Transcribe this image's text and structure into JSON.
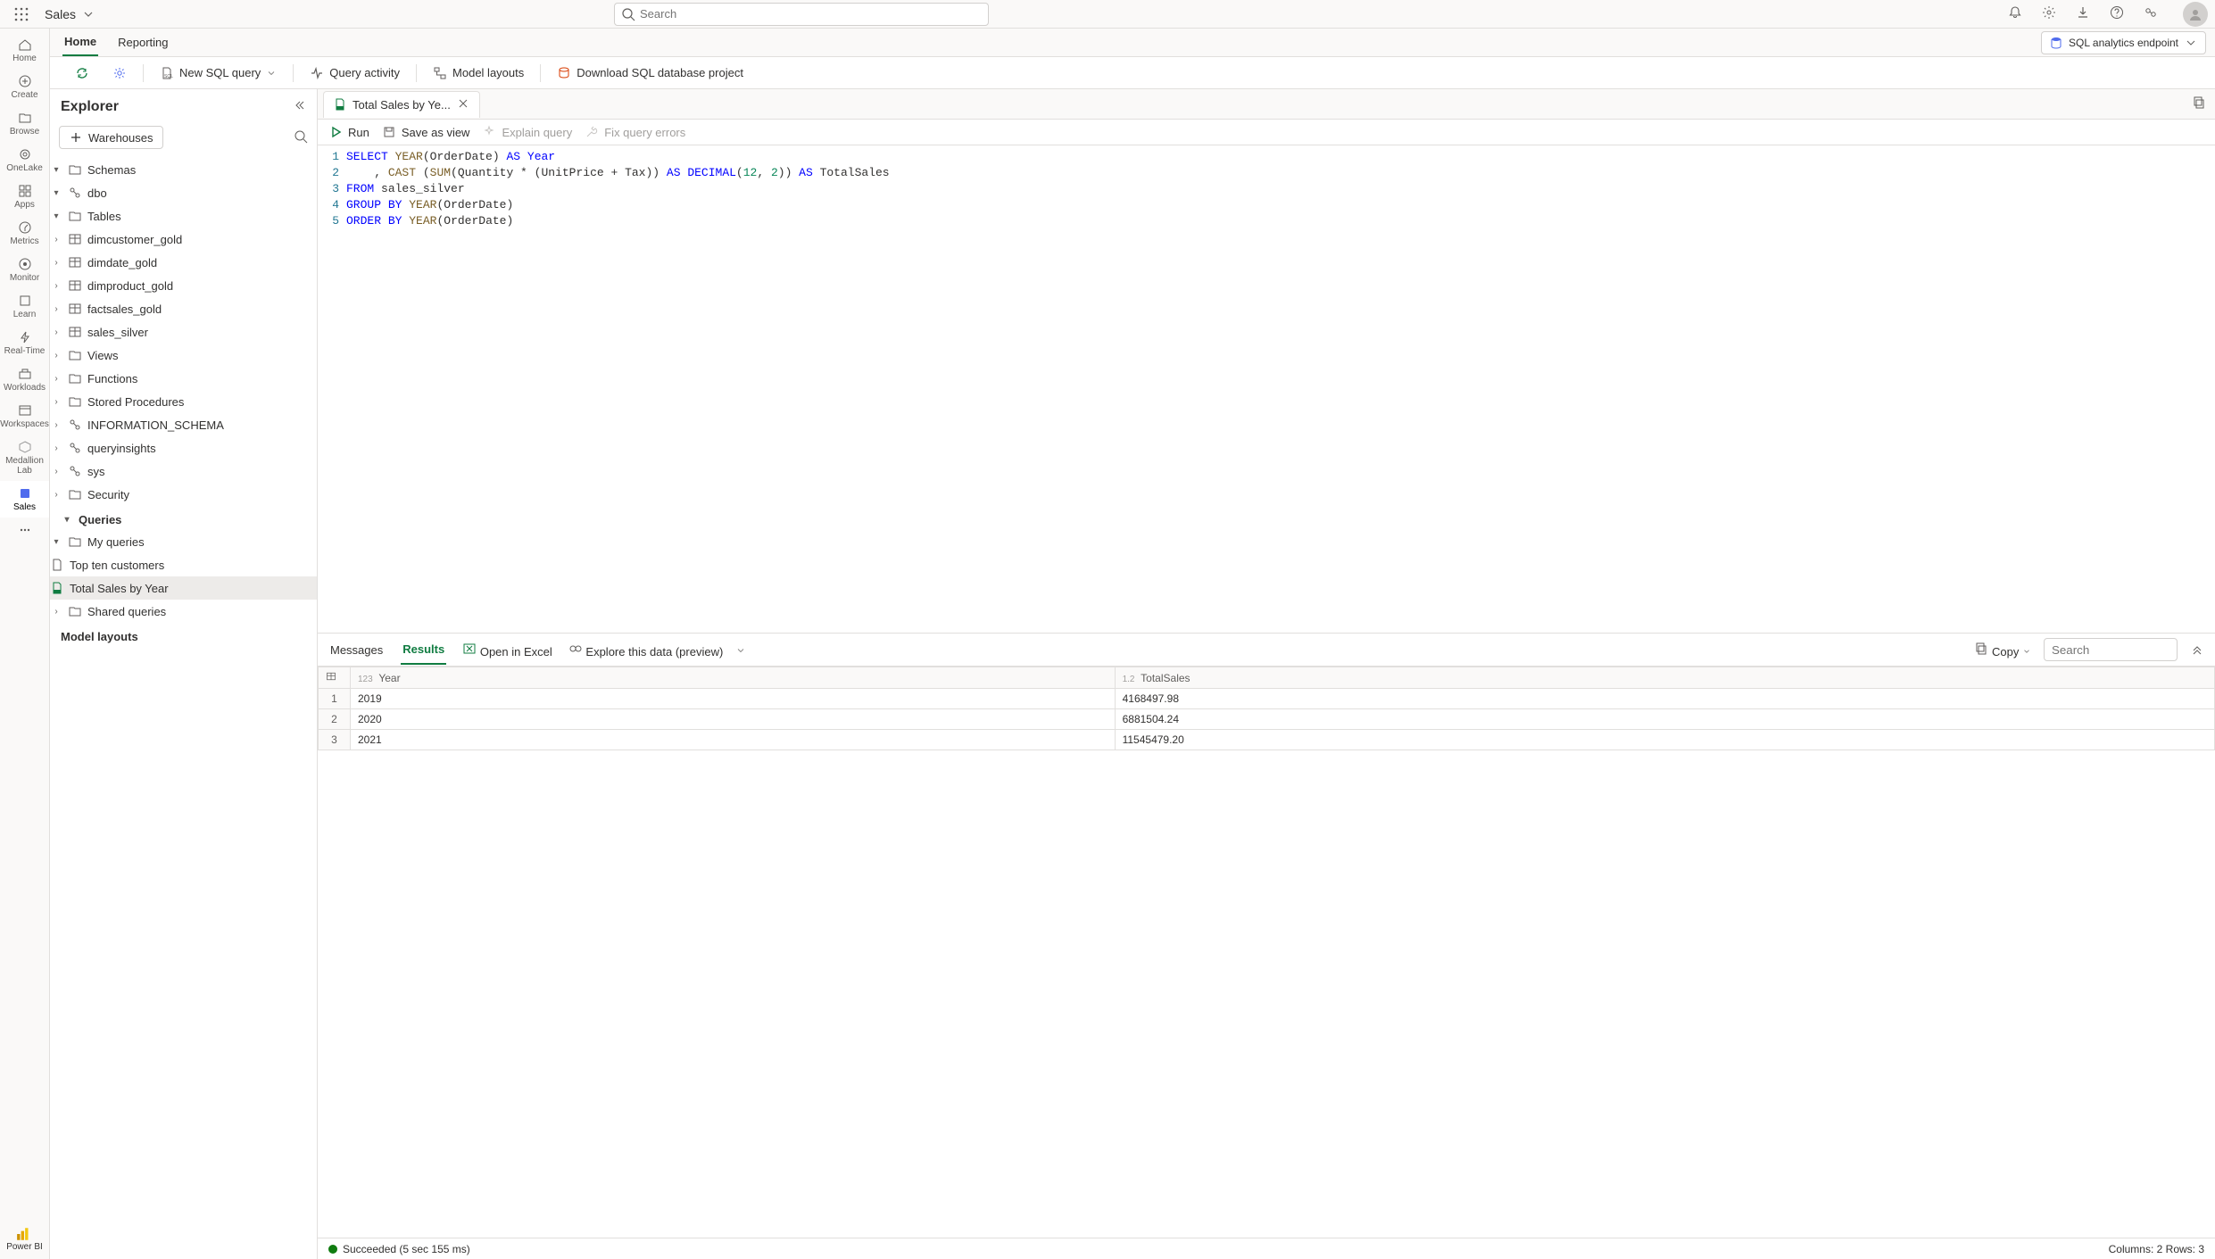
{
  "workspace_name": "Sales",
  "search_placeholder": "Search",
  "sec_tabs": {
    "home": "Home",
    "reporting": "Reporting"
  },
  "endpoint_label": "SQL analytics endpoint",
  "toolbar": {
    "new_query": "New SQL query",
    "query_activity": "Query activity",
    "model_layouts": "Model layouts",
    "download_project": "Download SQL database project"
  },
  "leftrail": {
    "home": "Home",
    "create": "Create",
    "browse": "Browse",
    "onelake": "OneLake",
    "apps": "Apps",
    "metrics": "Metrics",
    "monitor": "Monitor",
    "learn": "Learn",
    "realtime": "Real-Time",
    "workloads": "Workloads",
    "workspaces": "Workspaces",
    "medallion": "Medallion Lab",
    "sales": "Sales",
    "powerbi": "Power BI"
  },
  "explorer": {
    "title": "Explorer",
    "warehouses": "Warehouses",
    "schemas": "Schemas",
    "dbo": "dbo",
    "tables": "Tables",
    "table_list": [
      "dimcustomer_gold",
      "dimdate_gold",
      "dimproduct_gold",
      "factsales_gold",
      "sales_silver"
    ],
    "views": "Views",
    "functions": "Functions",
    "stored_procs": "Stored Procedures",
    "info_schema": "INFORMATION_SCHEMA",
    "queryinsights": "queryinsights",
    "sys": "sys",
    "security": "Security",
    "queries": "Queries",
    "my_queries": "My queries",
    "query_list": [
      "Top ten customers",
      "Total Sales by Year"
    ],
    "shared_queries": "Shared queries",
    "model_layouts": "Model layouts"
  },
  "filetab": {
    "label": "Total Sales by Ye..."
  },
  "qtoolbar": {
    "run": "Run",
    "save_view": "Save as view",
    "explain": "Explain query",
    "fix": "Fix query errors"
  },
  "sql_lines": [
    "SELECT YEAR(OrderDate) AS Year",
    "    , CAST (SUM(Quantity * (UnitPrice + Tax)) AS DECIMAL(12, 2)) AS TotalSales",
    "FROM sales_silver",
    "GROUP BY YEAR(OrderDate)",
    "ORDER BY YEAR(OrderDate)"
  ],
  "results": {
    "messages_tab": "Messages",
    "results_tab": "Results",
    "open_excel": "Open in Excel",
    "explore": "Explore this data (preview)",
    "copy": "Copy",
    "search_placeholder": "Search",
    "columns": [
      "Year",
      "TotalSales"
    ],
    "col_types": [
      "123",
      "1.2"
    ],
    "rows": [
      [
        "2019",
        "4168497.98"
      ],
      [
        "2020",
        "6881504.24"
      ],
      [
        "2021",
        "11545479.20"
      ]
    ]
  },
  "status": {
    "text": "Succeeded (5 sec 155 ms)",
    "summary": "Columns: 2 Rows: 3"
  },
  "chart_data": {
    "type": "table",
    "columns": [
      "Year",
      "TotalSales"
    ],
    "rows": [
      [
        2019,
        4168497.98
      ],
      [
        2020,
        6881504.24
      ],
      [
        2021,
        11545479.2
      ]
    ]
  }
}
